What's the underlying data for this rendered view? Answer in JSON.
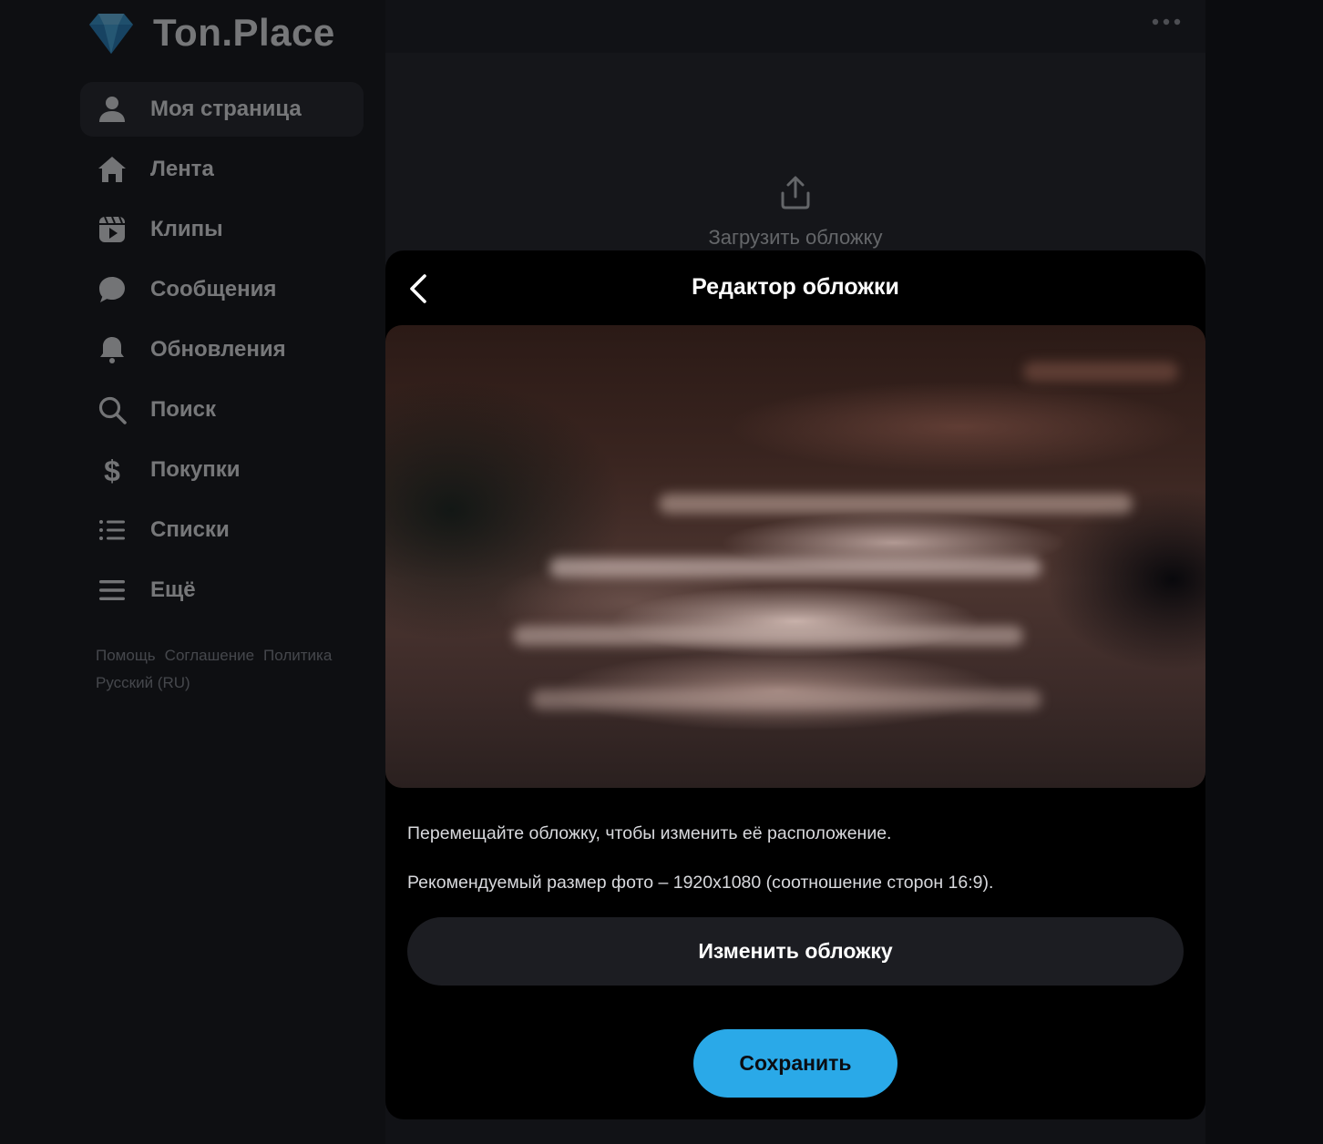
{
  "brand": {
    "name": "Ton.Place"
  },
  "sidebar": {
    "items": [
      {
        "label": "Моя страница",
        "icon": "user-icon",
        "active": true
      },
      {
        "label": "Лента",
        "icon": "home-icon"
      },
      {
        "label": "Клипы",
        "icon": "clips-icon"
      },
      {
        "label": "Сообщения",
        "icon": "chat-icon"
      },
      {
        "label": "Обновления",
        "icon": "bell-icon"
      },
      {
        "label": "Поиск",
        "icon": "search-icon"
      },
      {
        "label": "Покупки",
        "icon": "dollar-icon"
      },
      {
        "label": "Списки",
        "icon": "list-icon"
      },
      {
        "label": "Ещё",
        "icon": "menu-icon"
      }
    ],
    "footer": {
      "links": [
        "Помощь",
        "Соглашение",
        "Политика"
      ],
      "language": "Русский (RU)"
    }
  },
  "main": {
    "upload_cover_label": "Загрузить обложку"
  },
  "modal": {
    "title": "Редактор обложки",
    "hint_move": "Перемещайте обложку, чтобы изменить её расположение.",
    "hint_size": "Рекомендуемый размер фото – 1920x1080 (соотношение сторон 16:9).",
    "change_button": "Изменить обложку",
    "save_button": "Сохранить"
  },
  "colors": {
    "accent": "#2aa9e8",
    "background": "#16181e",
    "modal": "#000000"
  }
}
